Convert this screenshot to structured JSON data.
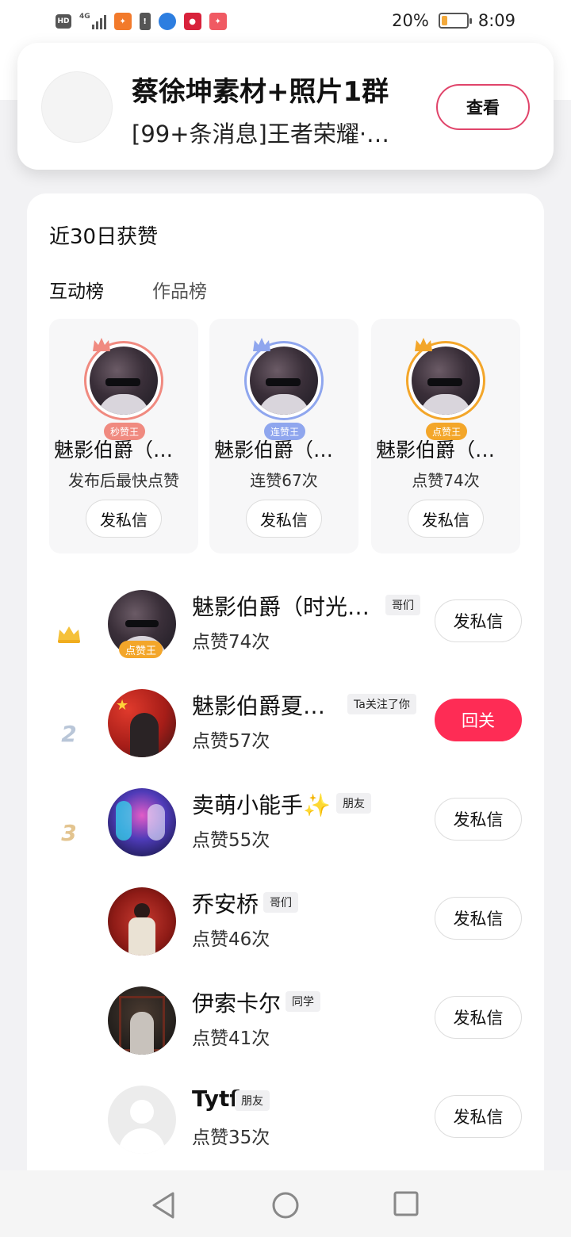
{
  "status_bar": {
    "battery_text": "20%",
    "battery_level": 0.2,
    "time": "8:09",
    "network": "4G",
    "icons": [
      "hd-icon",
      "4g-signal-icon",
      "app-icon",
      "warning-icon",
      "browser-icon",
      "camera-app-icon",
      "app-icon"
    ]
  },
  "notification": {
    "title": "蔡徐坤素材+照片1群",
    "message": "[99+条消息]王者荣耀·…",
    "button": "查看",
    "accent": "#e0446a"
  },
  "section": {
    "title": "近30日获赞",
    "tabs": [
      "互动榜",
      "作品榜"
    ]
  },
  "top3": [
    {
      "name": "魅影伯爵（…",
      "badge": "秒赞王",
      "stat": "发布后最快点赞",
      "button": "发私信",
      "color": "#f08a80"
    },
    {
      "name": "魅影伯爵（…",
      "badge": "连赞王",
      "stat": "连赞67次",
      "button": "发私信",
      "color": "#8fa6ee"
    },
    {
      "name": "魅影伯爵（…",
      "badge": "点赞王",
      "stat": "点赞74次",
      "button": "发私信",
      "color": "#f3a62a"
    }
  ],
  "rank_list": [
    {
      "rank": "",
      "name": "魅影伯爵（时光…",
      "tag": "哥们",
      "stat": "点赞74次",
      "button": "发私信",
      "badge": "点赞王"
    },
    {
      "rank": "2",
      "name": "魅影伯爵夏…",
      "tag": "Ta关注了你",
      "stat": "点赞57次",
      "button": "回关"
    },
    {
      "rank": "3",
      "name": "卖萌小能手✨",
      "tag": "朋友",
      "stat": "点赞55次",
      "button": "发私信"
    },
    {
      "rank": "",
      "name": "乔安桥",
      "tag": "哥们",
      "stat": "点赞46次",
      "button": "发私信"
    },
    {
      "rank": "",
      "name": "伊索卡尔",
      "tag": "同学",
      "stat": "点赞41次",
      "button": "发私信"
    },
    {
      "rank": "",
      "name": "Tytf",
      "tag": "朋友",
      "stat": "点赞35次",
      "button": "发私信"
    }
  ],
  "colors": {
    "follow_button": "#fe2c55",
    "rank2": "#b9c6d8",
    "rank3": "#e3c48f"
  },
  "nav": [
    "back-icon",
    "home-icon",
    "recents-icon"
  ]
}
